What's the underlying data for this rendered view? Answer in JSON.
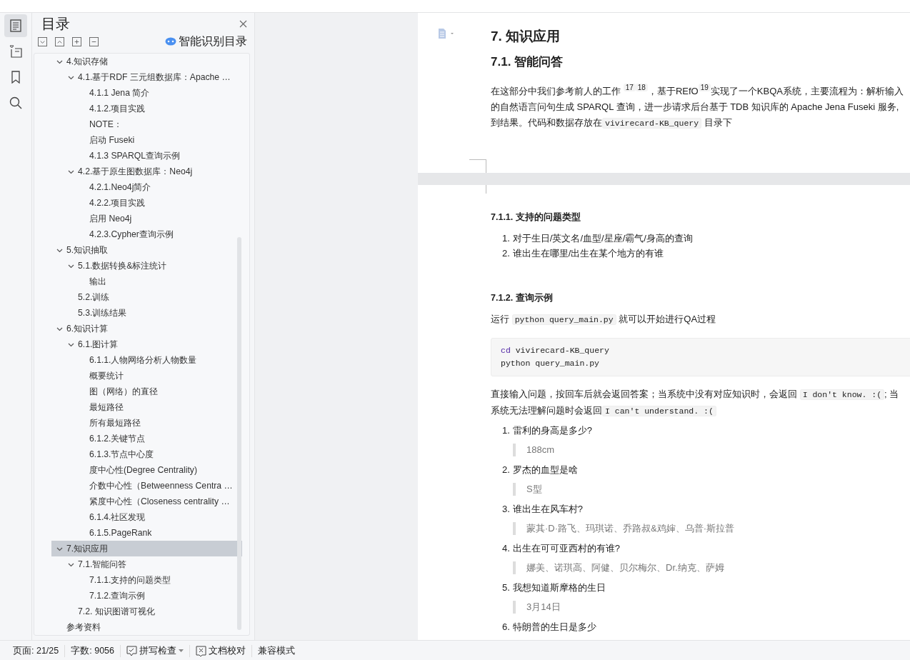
{
  "rail": {
    "items": [
      {
        "kind": "toc",
        "selected": true
      },
      {
        "kind": "outline",
        "selected": false
      },
      {
        "kind": "bookmark",
        "selected": false
      },
      {
        "kind": "search",
        "selected": false
      }
    ]
  },
  "toc": {
    "title": "目录",
    "smart_label": "智能识别目录",
    "items": [
      {
        "label": "4.知识存储",
        "expanded": true,
        "selected": false,
        "children": [
          {
            "label": "4.1.基于RDF 三元组数据库：Apache …",
            "expanded": true,
            "selected": false,
            "children": [
              {
                "label": "4.1.1 Jena 简介",
                "selected": false
              },
              {
                "label": "4.1.2.项目实践",
                "selected": false
              },
              {
                "label": "NOTE：",
                "selected": false
              },
              {
                "label": "启动 Fuseki",
                "selected": false
              },
              {
                "label": "4.1.3 SPARQL查询示例",
                "selected": false
              }
            ]
          },
          {
            "label": "4.2.基于原生图数据库：Neo4j",
            "expanded": true,
            "selected": false,
            "children": [
              {
                "label": "4.2.1.Neo4j简介",
                "selected": false
              },
              {
                "label": "4.2.2.项目实践",
                "selected": false
              },
              {
                "label": "启用 Neo4j",
                "selected": false
              },
              {
                "label": "4.2.3.Cypher查询示例",
                "selected": false
              }
            ]
          }
        ]
      },
      {
        "label": "5.知识抽取",
        "expanded": true,
        "selected": false,
        "children": [
          {
            "label": "5.1.数据转换&标注统计",
            "expanded": true,
            "selected": false,
            "children": [
              {
                "label": "输出",
                "selected": false
              }
            ]
          },
          {
            "label": "5.2.训练",
            "selected": false
          },
          {
            "label": "5.3.训练结果",
            "selected": false
          }
        ]
      },
      {
        "label": "6.知识计算",
        "expanded": true,
        "selected": false,
        "children": [
          {
            "label": "6.1.图计算",
            "expanded": true,
            "selected": false,
            "children": [
              {
                "label": "6.1.1.人物网络分析人物数量",
                "selected": false
              },
              {
                "label": "概要统计",
                "selected": false
              },
              {
                "label": "图（网络）的直径",
                "selected": false
              },
              {
                "label": "最短路径",
                "selected": false
              },
              {
                "label": "所有最短路径",
                "selected": false
              },
              {
                "label": "6.1.2.关键节点",
                "selected": false
              },
              {
                "label": "6.1.3.节点中心度",
                "selected": false
              },
              {
                "label": "度中心性(Degree Centrality)",
                "selected": false
              },
              {
                "label": "介数中心性（Betweenness Centra …",
                "selected": false
              },
              {
                "label": "紧度中心性（Closeness centrality …",
                "selected": false
              },
              {
                "label": "6.1.4.社区发现",
                "selected": false
              },
              {
                "label": "6.1.5.PageRank",
                "selected": false
              }
            ]
          }
        ]
      },
      {
        "label": "7.知识应用",
        "expanded": true,
        "selected": true,
        "children": [
          {
            "label": "7.1.智能问答",
            "expanded": true,
            "selected": false,
            "children": [
              {
                "label": "7.1.1.支持的问题类型",
                "selected": false
              },
              {
                "label": "7.1.2.查询示例",
                "selected": false
              }
            ]
          },
          {
            "label": "7.2. 知识图谱可视化",
            "selected": false
          }
        ]
      },
      {
        "label": "参考资料",
        "selected": false
      }
    ]
  },
  "document": {
    "h1": "7. 知识应用",
    "h2": "7.1. 智能问答",
    "intro": [
      {
        "kind": "text",
        "text": "在这部分中我们参考前人的工作 "
      },
      {
        "kind": "sup",
        "text": "17"
      },
      {
        "kind": "sup",
        "text": "18"
      },
      {
        "kind": "text",
        "text": "，基于REfO"
      },
      {
        "kind": "sup",
        "text": "19"
      },
      {
        "kind": "text",
        "text": "实现了一个KBQA系统，主要流程为：解析输入"
      },
      {
        "kind": "break"
      },
      {
        "kind": "text",
        "text": "的自然语言问句生成 SPARQL 查询，进一步请求后台基于 TDB 知识库的 Apache Jena Fuseki 服务,"
      },
      {
        "kind": "break"
      },
      {
        "kind": "text",
        "text": "到结果。代码和数据存放在"
      },
      {
        "kind": "code",
        "text": "vivirecard-KB_query"
      },
      {
        "kind": "text",
        "text": " 目录下"
      }
    ],
    "h3_types": "7.1.1. 支持的问题类型",
    "types": [
      {
        "number": "1.",
        "text": "对于生日/英文名/血型/星座/霸气/身高的查询"
      },
      {
        "number": "2.",
        "text": "谁出生在哪里/出生在某个地方的有谁"
      }
    ],
    "h3_examples": "7.1.2. 查询示例",
    "run": [
      {
        "kind": "text",
        "text": "运行 "
      },
      {
        "kind": "code",
        "text": "python query_main.py"
      },
      {
        "kind": "text",
        "text": " 就可以开始进行QA过程"
      }
    ],
    "code_block": [
      {
        "keyword": "cd",
        "text": " vivirecard-KB_query"
      },
      {
        "text": "python query_main.py"
      }
    ],
    "usage": [
      {
        "kind": "text",
        "text": "直接输入问题，按回车后就会返回答案；当系统中没有对应知识时，会返回 "
      },
      {
        "kind": "code",
        "text": "I don't know. :("
      },
      {
        "kind": "text",
        "text": "; 当"
      },
      {
        "kind": "break"
      },
      {
        "kind": "text",
        "text": "系统无法理解问题时会返回"
      },
      {
        "kind": "code",
        "text": "I can't understand. :("
      }
    ],
    "examples": [
      {
        "number": "1.",
        "question": "雷利的身高是多少?",
        "answer": "188cm"
      },
      {
        "number": "2.",
        "question": "罗杰的血型是啥",
        "answer": "S型"
      },
      {
        "number": "3.",
        "question": "谁出生在风车村?",
        "answer": "蒙其·D·路飞、玛琪诺、乔路叔&鸡婶、乌普·斯拉普"
      },
      {
        "number": "4.",
        "question": "出生在可可亚西村的有谁?",
        "answer": "娜美、诺琪高、阿健、贝尔梅尔、Dr.纳克、萨姆"
      },
      {
        "number": "5.",
        "question": "我想知道斯摩格的生日",
        "answer": "3月14日"
      },
      {
        "number": "6.",
        "question": "特朗普的生日是多少"
      }
    ]
  },
  "status_bar": {
    "page": "页面: 21/25",
    "words": "字数: 9056",
    "spell": "拼写检查",
    "proof": "文档校对",
    "compat": "兼容模式"
  }
}
